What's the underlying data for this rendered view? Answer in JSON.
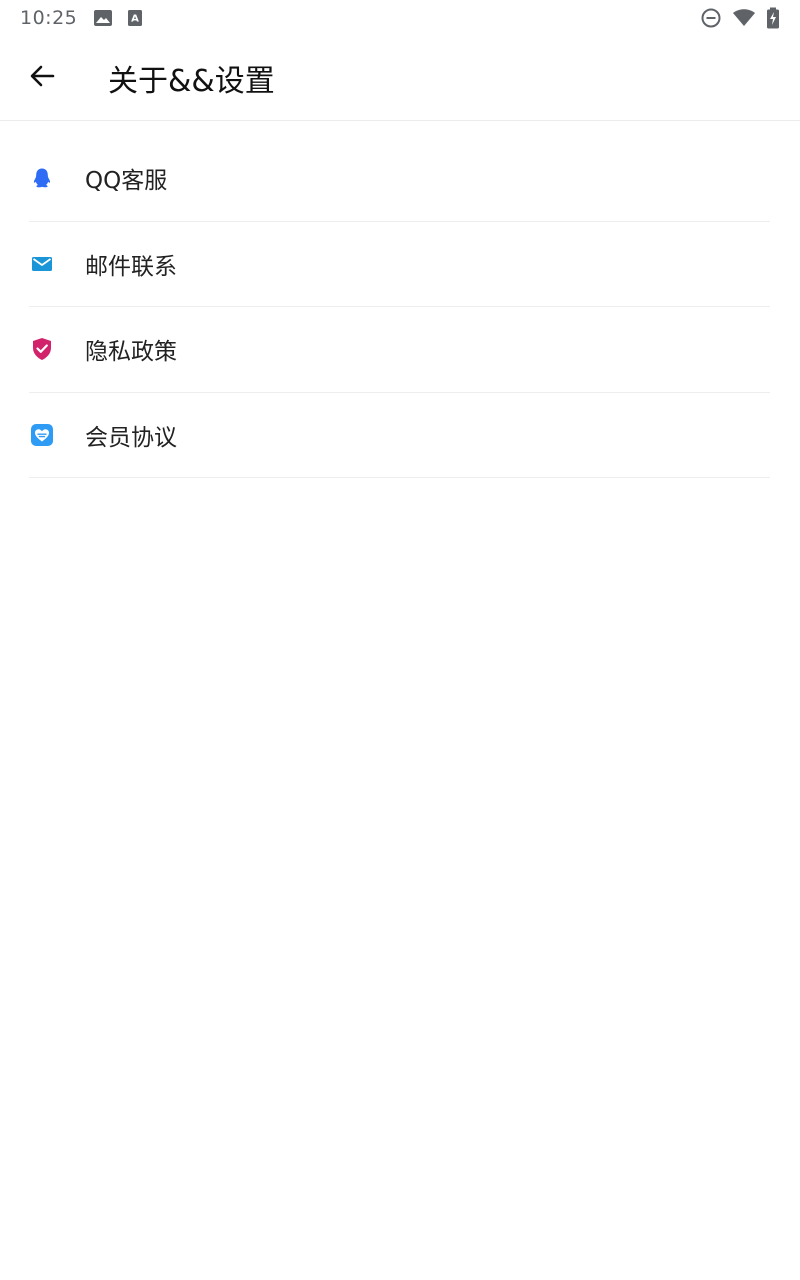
{
  "status_bar": {
    "time": "10:25",
    "left_icons": [
      "image-icon",
      "font-icon"
    ],
    "right_icons": [
      "do-not-disturb-icon",
      "wifi-icon",
      "battery-charging-icon"
    ]
  },
  "app_bar": {
    "back_icon": "arrow-left-icon",
    "title": "关于&&设置"
  },
  "menu": {
    "items": [
      {
        "label": "QQ客服",
        "icon": "qq-penguin-icon",
        "color": "#2f6cf6"
      },
      {
        "label": "邮件联系",
        "icon": "mail-icon",
        "color": "#1a96d8"
      },
      {
        "label": "隐私政策",
        "icon": "shield-check-icon",
        "color": "#d2226c"
      },
      {
        "label": "会员协议",
        "icon": "member-heart-icon",
        "color": "#2e9cf5"
      }
    ]
  }
}
